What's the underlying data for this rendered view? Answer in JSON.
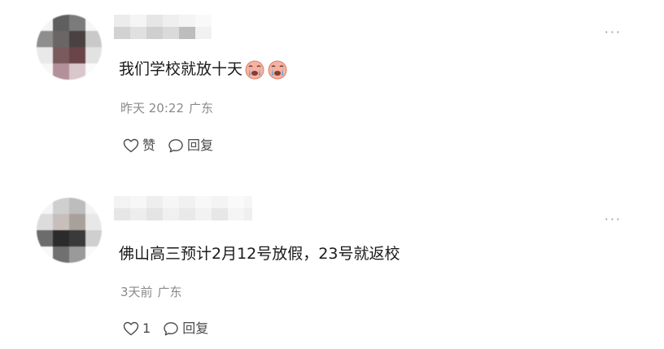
{
  "comments": [
    {
      "content": "我们学校就放十天",
      "emojis": [
        "crying-face-emoji",
        "crying-face-emoji"
      ],
      "time": "昨天 20:22",
      "location": "广东",
      "like_label": "赞",
      "reply_label": "回复",
      "more_label": "···"
    },
    {
      "content": "佛山高三预计2月12号放假，23号就返校",
      "time": "3天前",
      "location": "广东",
      "like_label": "1",
      "reply_label": "回复",
      "more_label": "···"
    }
  ],
  "colors": {
    "text": "#1a1a1a",
    "meta": "#8a8a8a",
    "action": "#4a4a4a",
    "background": "#ffffff"
  },
  "icons": {
    "like": "heart-outline-icon",
    "reply": "speech-bubble-icon",
    "more": "more-dots-icon"
  }
}
